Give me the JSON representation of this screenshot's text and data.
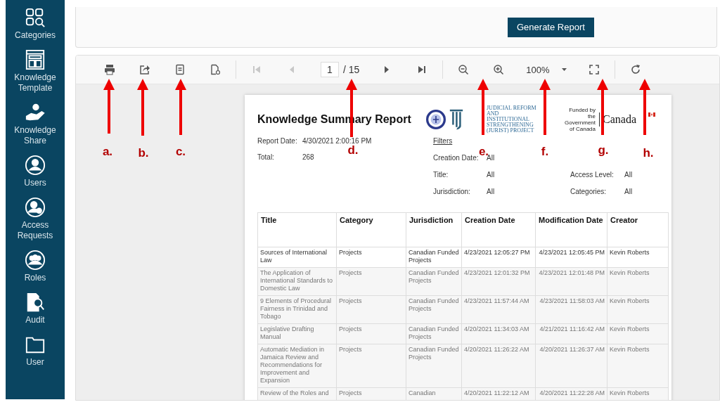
{
  "sidebar": {
    "items": [
      {
        "label": "Categories"
      },
      {
        "label": "Knowledge Template"
      },
      {
        "label": "Knowledge Share"
      },
      {
        "label": "Users"
      },
      {
        "label": "Access Requests"
      },
      {
        "label": "Roles"
      },
      {
        "label": "Audit"
      },
      {
        "label": "User"
      }
    ]
  },
  "top_panel": {
    "button": "Generate Report"
  },
  "toolbar": {
    "first_disabled": true,
    "prev_disabled": true,
    "page": "1",
    "page_count": "/ 15",
    "zoom": "100%"
  },
  "report": {
    "title": "Knowledge Summary Report",
    "logo_text": "JUDICIAL REFORM AND INSTITUTIONAL STRENGTHENING (JURIST) PROJECT",
    "funded_text": "Funded by the Government of Canada",
    "canada": "Canada",
    "meta": [
      {
        "label": "Report Date:",
        "value": "4/30/2021 2:00:16 PM"
      },
      {
        "label": "Total:",
        "value": "268"
      }
    ],
    "filters_heading": "Filters",
    "filters": [
      {
        "label": "Creation Date:",
        "value": "All"
      },
      {
        "label": "Title:",
        "value": "All"
      },
      {
        "label": "Jurisdiction:",
        "value": "All"
      },
      {
        "label": "Access Level:",
        "value": "All"
      },
      {
        "label": "Categories:",
        "value": "All"
      }
    ],
    "columns": [
      "Title",
      "Category",
      "Jurisdiction",
      "Creation Date",
      "Modification Date",
      "Creator"
    ],
    "rows": [
      [
        "Sources of International Law",
        "Projects",
        "Canadian Funded Projects",
        "4/23/2021 12:05:27 PM",
        "4/23/2021 12:05:45 PM",
        "Kevin Roberts"
      ],
      [
        "The Application of International Standards to Domestic Law",
        "Projects",
        "Canadian Funded Projects",
        "4/23/2021 12:01:32 PM",
        "4/23/2021 12:01:48 PM",
        "Kevin Roberts"
      ],
      [
        "9 Elements of Procedural Fairness in Trinidad and Tobago",
        "Projects",
        "Canadian Funded Projects",
        "4/23/2021 11:57:44 AM",
        "4/23/2021 11:58:03 AM",
        "Kevin Roberts"
      ],
      [
        "Legislative Drafting Manual",
        "Projects",
        "Canadian Funded Projects",
        "4/20/2021 11:34:03 AM",
        "4/21/2021 11:16:42 AM",
        "Kevin Roberts"
      ],
      [
        "Automatic Mediation in Jamaica Review and Recommendations for Improvement and Expansion",
        "Projects",
        "Canadian Funded Projects",
        "4/20/2021 11:26:22 AM",
        "4/20/2021 11:26:37 AM",
        "Kevin Roberts"
      ],
      [
        "Review of the Roles and",
        "Projects",
        "Canadian",
        "4/20/2021 11:22:12 AM",
        "4/20/2021 11:22:28 AM",
        "Kevin Roberts"
      ]
    ]
  },
  "annotations": [
    {
      "label": "a."
    },
    {
      "label": "b."
    },
    {
      "label": "c."
    },
    {
      "label": "d."
    },
    {
      "label": "e."
    },
    {
      "label": "f."
    },
    {
      "label": "g."
    },
    {
      "label": "h."
    }
  ]
}
